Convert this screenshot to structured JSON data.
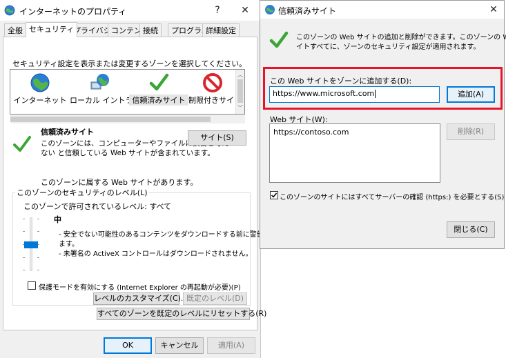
{
  "internet_options": {
    "title": "インターネットのプロパティ",
    "help_button": "?",
    "close_button": "✕",
    "tabs": [
      {
        "label": "全般"
      },
      {
        "label": "セキュリティ"
      },
      {
        "label": "プライバシー"
      },
      {
        "label": "コンテンツ"
      },
      {
        "label": "接続"
      },
      {
        "label": "プログラム"
      },
      {
        "label": "詳細設定"
      }
    ],
    "active_tab": "セキュリティ",
    "zone_prompt": "セキュリティ設定を表示または変更するゾーンを選択してください。",
    "zones": [
      {
        "label": "インターネット",
        "icon": "globe-icon"
      },
      {
        "label": "ローカル イントラネット",
        "icon": "intranet-icon"
      },
      {
        "label": "信頼済みサイト",
        "icon": "checkmark-icon"
      },
      {
        "label": "制限付きサイト",
        "icon": "restricted-icon"
      }
    ],
    "selected_zone": "信頼済みサイト",
    "zone_info": {
      "title": "信頼済みサイト",
      "description_line1": "このゾーンには、コンピューターやファイルに損害を与え",
      "description_line2": "ない と信頼している Web サイトが含まれています。",
      "has_sites_text": "このゾーンに属する Web サイトがあります。",
      "sites_button": "サイト(S)"
    },
    "security_level": {
      "group_title": "このゾーンのセキュリティのレベル(L)",
      "allowed_levels": "このゾーンで許可されているレベル: すべて",
      "level_name": "中",
      "bullet1_line1": "- 安全でない可能性のあるコンテンツをダウンロードする前に警告し",
      "bullet1_line2": "ます。",
      "bullet2": "- 未署名の ActiveX コントロールはダウンロードされません。",
      "slider_level": 3,
      "slider_levels_total": 5
    },
    "protected_mode_label": "保護モードを有効にする (Internet Explorer の再起動が必要)(P)",
    "protected_mode_checked": false,
    "custom_level_button": "レベルのカスタマイズ(C)...",
    "default_level_button": "既定のレベル(D)",
    "reset_all_button": "すべてのゾーンを既定のレベルにリセットする(R)",
    "ok_button": "OK",
    "cancel_button": "キャンセル",
    "apply_button": "適用(A)"
  },
  "trusted_sites": {
    "title": "信頼済みサイト",
    "close_button": "✕",
    "info_line1": "このゾーンの Web サイトの追加と削除ができます。このゾーンの Web サ",
    "info_line2": "イトすべてに、ゾーンのセキュリティ設定が適用されます。",
    "add_label": "この Web サイトをゾーンに追加する(D):",
    "add_input_value": "https://www.microsoft.com",
    "add_button": "追加(A)",
    "websites_label": "Web サイト(W):",
    "websites": [
      "https://contoso.com"
    ],
    "remove_button": "削除(R)",
    "require_https_label": "このゾーンのサイトにはすべてサーバーの確認 (https:) を必要とする(S)",
    "require_https_checked": true,
    "close_dialog_button": "閉じる(C)"
  },
  "colors": {
    "accent": "#0078d7",
    "highlight_red": "#e8132a",
    "check_green": "#3aa635"
  }
}
